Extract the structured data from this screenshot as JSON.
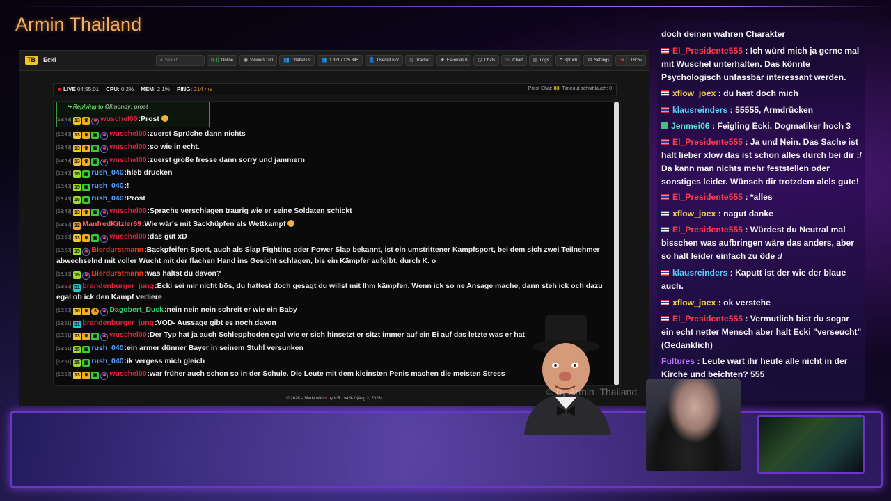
{
  "brand": "Armin Thailand",
  "watermark": "© by Armin_Thailand",
  "app": {
    "logo": "TB",
    "channel": "Ecki",
    "search_placeholder": "Search...",
    "nav": [
      {
        "icon": "online-icon",
        "glyph": "((·))",
        "label": "Online"
      },
      {
        "icon": "eye-icon",
        "glyph": "◉",
        "label": "Viewers  100"
      },
      {
        "icon": "users-icon",
        "glyph": "👥",
        "label": "Chatters  9"
      },
      {
        "icon": "users-icon",
        "glyph": "👥",
        "label": "1.321 / 125.345"
      },
      {
        "icon": "user-icon",
        "glyph": "👤",
        "label": "Userlist  627"
      },
      {
        "icon": "tracker-icon",
        "glyph": "◎",
        "label": "Tracker"
      },
      {
        "icon": "star-icon",
        "glyph": "★",
        "label": "Favorites  0"
      },
      {
        "icon": "clock-icon",
        "glyph": "◷",
        "label": "Chats"
      },
      {
        "icon": "chart-icon",
        "glyph": "〰",
        "label": "Chart"
      },
      {
        "icon": "logs-icon",
        "glyph": "▤",
        "label": "Logs"
      },
      {
        "icon": "quote-icon",
        "glyph": "❝",
        "label": "Spruch"
      },
      {
        "icon": "gear-icon",
        "glyph": "⚙",
        "label": "Settings"
      },
      {
        "icon": "logout-icon",
        "glyph": "⇥",
        "label": "Logout"
      }
    ],
    "clock": "18:52",
    "status": {
      "live_label": "LIVE",
      "live_time": "04:55:01",
      "cpu_label": "CPU:",
      "cpu_value": "0.2%",
      "mem_label": "MEM:",
      "mem_value": "2.1%",
      "ping_label": "PING:",
      "ping_value": "214 ms",
      "right_prefix": "Prost Chat:",
      "right_count": "83",
      "right_suffix": "Timeout schnittlauch: 0"
    },
    "reply": {
      "label": "Replying to",
      "who": "Olimondy: prost"
    },
    "messages": [
      {
        "ts": "[18:48]",
        "lvl": "13",
        "cls": "",
        "crown": true,
        "gift": false,
        "coin": false,
        "flag": true,
        "user": "wuschel00",
        "ucls": "u-red",
        "text": "Prost",
        "emoji": true
      },
      {
        "ts": "[18:48]",
        "lvl": "13",
        "cls": "",
        "crown": true,
        "gift": true,
        "coin": false,
        "flag": true,
        "user": "wuschel00",
        "ucls": "u-red",
        "text": "zuerst Sprüche dann nichts"
      },
      {
        "ts": "[18:49]",
        "lvl": "13",
        "cls": "",
        "crown": true,
        "gift": true,
        "coin": false,
        "flag": true,
        "user": "wuschel00",
        "ucls": "u-red",
        "text": "so wie in echt."
      },
      {
        "ts": "[18:49]",
        "lvl": "13",
        "cls": "",
        "crown": true,
        "gift": true,
        "coin": false,
        "flag": true,
        "user": "wuschel00",
        "ucls": "u-red",
        "text": "zuerst große fresse dann sorry und jammern"
      },
      {
        "ts": "[18:49]",
        "lvl": "15",
        "cls": "b15",
        "crown": false,
        "gift": true,
        "coin": false,
        "flag": false,
        "user": "rush_040",
        "ucls": "u-blue",
        "text": "hleb drücken"
      },
      {
        "ts": "[18:49]",
        "lvl": "15",
        "cls": "b15",
        "crown": false,
        "gift": true,
        "coin": false,
        "flag": false,
        "user": "rush_040",
        "ucls": "u-blue",
        "text": "!"
      },
      {
        "ts": "[18:49]",
        "lvl": "15",
        "cls": "b15",
        "crown": false,
        "gift": true,
        "coin": false,
        "flag": false,
        "user": "rush_040",
        "ucls": "u-blue",
        "text": "Prost"
      },
      {
        "ts": "[18:49]",
        "lvl": "13",
        "cls": "",
        "crown": true,
        "gift": true,
        "coin": false,
        "flag": true,
        "user": "wuschel00",
        "ucls": "u-red",
        "text": "Sprache verschlagen traurig wie er seine Soldaten schickt"
      },
      {
        "ts": "[18:50]",
        "lvl": "12",
        "cls": "b12",
        "crown": false,
        "gift": false,
        "coin": false,
        "flag": false,
        "user": "ManfredKitzler69",
        "ucls": "u-pink",
        "text": "Wie wär's mit Sackhüpfen als Wettkampf",
        "emoji": true
      },
      {
        "ts": "[18:50]",
        "lvl": "13",
        "cls": "",
        "crown": true,
        "gift": true,
        "coin": false,
        "flag": true,
        "user": "wuschel00",
        "ucls": "u-red",
        "text": "das gut xD"
      },
      {
        "ts": "[18:50]",
        "lvl": "15",
        "cls": "b15",
        "crown": false,
        "gift": false,
        "coin": false,
        "flag": true,
        "user": "Bierdurstmann",
        "ucls": "u-orange",
        "text": "Backpfeifen-Sport, auch als Slap Fighting oder Power Slap bekannt, ist ein umstrittener Kampfsport, bei dem sich zwei Teilnehmer abwechselnd mit voller Wucht mit der flachen Hand ins Gesicht schlagen, bis ein Kämpfer aufgibt, durch K. o"
      },
      {
        "ts": "[18:50]",
        "lvl": "15",
        "cls": "b15",
        "crown": false,
        "gift": false,
        "coin": false,
        "flag": true,
        "user": "Bierdurstmann",
        "ucls": "u-orange",
        "text": "was hältst du davon?"
      },
      {
        "ts": "[18:50]",
        "lvl": "31",
        "cls": "b31",
        "crown": false,
        "gift": false,
        "coin": false,
        "flag": false,
        "user": "brandenburger_jung",
        "ucls": "u-red",
        "text": "Ecki sei mir nicht bös, du hattest doch gesagt du willst mit Ihm kämpfen. Wenn ick so ne Ansage mache, dann steh ick och dazu egal ob ick den Kampf verliere"
      },
      {
        "ts": "[18:50]",
        "lvl": "10",
        "cls": "",
        "crown": true,
        "gift": false,
        "coin": true,
        "flag": true,
        "user": "Dagobert_Duck",
        "ucls": "u-green",
        "text": "nein nein nein schreit er wie ein Baby"
      },
      {
        "ts": "[18:51]",
        "lvl": "31",
        "cls": "b31",
        "crown": false,
        "gift": false,
        "coin": false,
        "flag": false,
        "user": "brandenburger_jung",
        "ucls": "u-red",
        "text": "VOD- Aussage gibt es noch davon"
      },
      {
        "ts": "[18:51]",
        "lvl": "13",
        "cls": "",
        "crown": true,
        "gift": true,
        "coin": false,
        "flag": true,
        "user": "wuschel00",
        "ucls": "u-red",
        "text": "Der Typ hat ja auch Schlepphoden egal wie er sich hinsetzt er sitzt immer auf ein Ei auf das letzte was er hat"
      },
      {
        "ts": "[18:51]",
        "lvl": "15",
        "cls": "b15",
        "crown": false,
        "gift": true,
        "coin": false,
        "flag": false,
        "user": "rush_040",
        "ucls": "u-blue",
        "text": "ein armer dünner Bayer in seinem Stuhl versunken"
      },
      {
        "ts": "[18:51]",
        "lvl": "15",
        "cls": "b15",
        "crown": false,
        "gift": true,
        "coin": false,
        "flag": false,
        "user": "rush_040",
        "ucls": "u-blue",
        "text": "ik vergess mich gleich"
      },
      {
        "ts": "[18:52]",
        "lvl": "13",
        "cls": "",
        "crown": true,
        "gift": true,
        "coin": false,
        "flag": true,
        "user": "wuschel00",
        "ucls": "u-red",
        "text": "war früher auch schon so in der Schule. Die Leute mit dem kleinsten Penis machen die meisten Stress"
      }
    ],
    "footer": {
      "pre": "© 2026 – Made with",
      "post": "by tcR · v4.9-2 (Aug 2, 2026)"
    }
  },
  "side_chat": [
    {
      "flag": "",
      "user": "",
      "ucls": "",
      "text": "doch deinen wahren Charakter"
    },
    {
      "flag": "th",
      "user": "El_Presidente555",
      "ucls": "n-red",
      "text": "Ich würd mich ja gerne mal mit Wuschel unterhalten. Das könnte Psychologisch unfassbar interessant werden."
    },
    {
      "flag": "th",
      "user": "xflow_joex",
      "ucls": "n-yellow",
      "text": "du hast doch mich"
    },
    {
      "flag": "th",
      "user": "klausreinders",
      "ucls": "n-cyan",
      "text": "55555, Armdrücken"
    },
    {
      "flag": "mod",
      "user": "Jenmei06",
      "ucls": "n-teal",
      "text": "Feigling Ecki. Dogmatiker hoch 3"
    },
    {
      "flag": "th",
      "user": "El_Presidente555",
      "ucls": "n-red",
      "text": "Ja und Nein. Das Sache ist halt lieber xlow das ist schon alles durch bei dir :/ Da kann man nichts mehr feststellen oder sonstiges leider. Wünsch dir trotzdem alels gute!"
    },
    {
      "flag": "th",
      "user": "El_Presidente555",
      "ucls": "n-red",
      "text": "*alles"
    },
    {
      "flag": "th",
      "user": "xflow_joex",
      "ucls": "n-yellow",
      "text": "nagut danke"
    },
    {
      "flag": "th",
      "user": "El_Presidente555",
      "ucls": "n-red",
      "text": "Würdest du Neutral mal bisschen was aufbringen wäre das anders, aber so halt leider einfach zu öde :/"
    },
    {
      "flag": "th",
      "user": "klausreinders",
      "ucls": "n-cyan",
      "text": "Kaputt ist der wie der blaue auch."
    },
    {
      "flag": "th",
      "user": "xflow_joex",
      "ucls": "n-yellow",
      "text": "ok verstehe"
    },
    {
      "flag": "th",
      "user": "El_Presidente555",
      "ucls": "n-red",
      "text": "Vermutlich bist du sogar ein echt netter Mensch aber halt Ecki \"verseucht\" (Gedanklich)"
    },
    {
      "flag": "",
      "user": "Fultures",
      "ucls": "n-purple",
      "text": "Leute wart ihr heute alle nicht in der Kirche und beichten? 555"
    }
  ]
}
